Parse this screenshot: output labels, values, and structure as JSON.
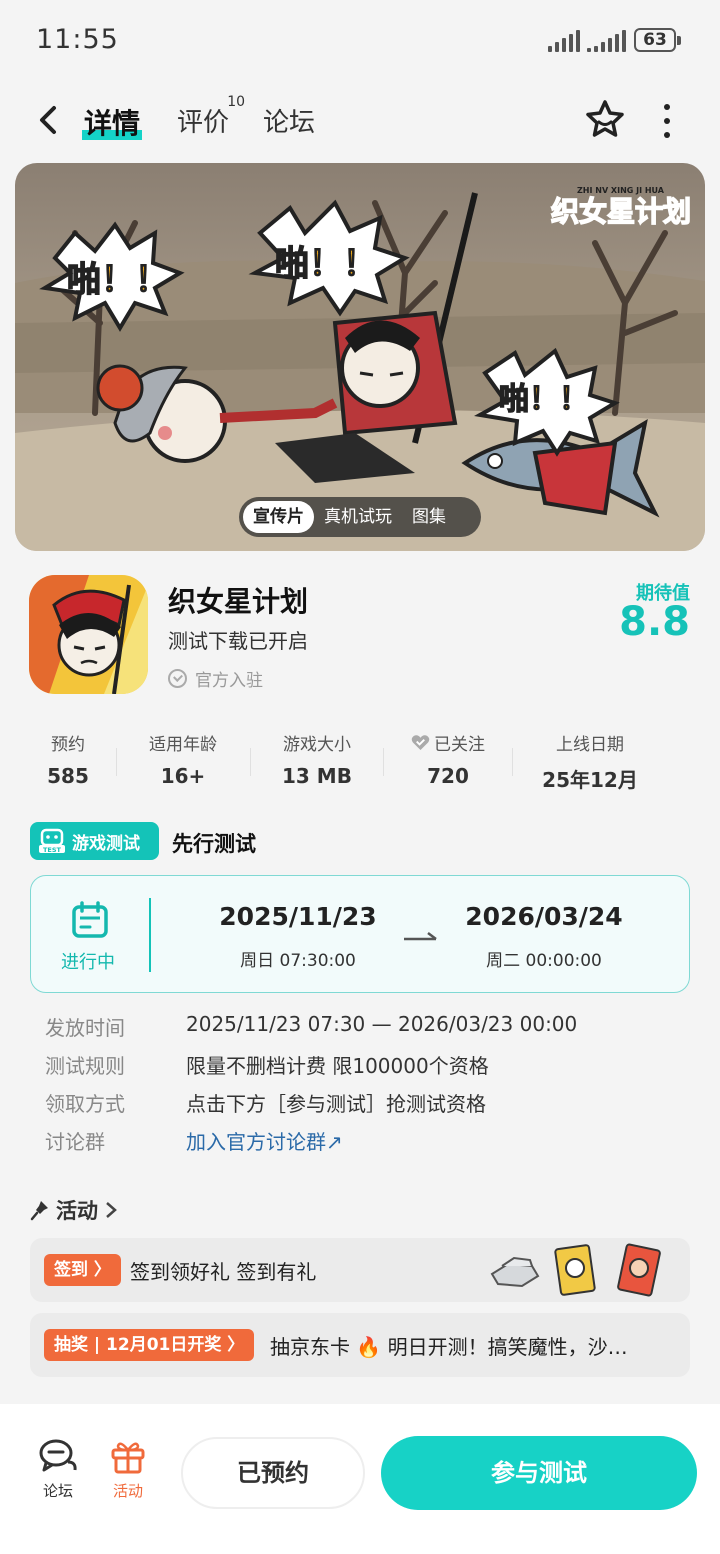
{
  "status_bar": {
    "time": "11:55",
    "battery": "63"
  },
  "nav": {
    "tabs": [
      {
        "label": "详情"
      },
      {
        "label": "评价",
        "badge": "10"
      },
      {
        "label": "论坛"
      }
    ]
  },
  "banner": {
    "logo_text": "织女星计划",
    "logo_pinyin": "ZHI NV XING JI HUA",
    "bubble_text": "啪！！",
    "media_tabs": [
      "宣传片",
      "真机试玩",
      "图集"
    ]
  },
  "app": {
    "name": "织女星计划",
    "subtitle": "测试下载已开启",
    "official": "官方入驻",
    "expect_label": "期待值",
    "expect_value": "8.8"
  },
  "stats": [
    {
      "label": "预约",
      "value": "585"
    },
    {
      "label": "适用年龄",
      "value": "16+"
    },
    {
      "label": "游戏大小",
      "value": "13 MB"
    },
    {
      "label": "已关注",
      "value": "720"
    },
    {
      "label": "上线日期",
      "value": "25年12月"
    }
  ],
  "test": {
    "badge": "游戏测试",
    "badge_icon_text": "TEST",
    "title": "先行测试",
    "status": "进行中",
    "start_date": "2025/11/23",
    "start_time": "周日  07:30:00",
    "end_date": "2026/03/24",
    "end_time": "周二   00:00:00",
    "rules": [
      {
        "key": "发放时间",
        "value": "2025/11/23 07:30 — 2026/03/23 00:00"
      },
      {
        "key": "测试规则",
        "value": "限量不删档计费 限100000个资格"
      },
      {
        "key": "领取方式",
        "value": "点击下方［参与测试］抢测试资格"
      },
      {
        "key": "讨论群",
        "value": "加入官方讨论群↗"
      }
    ]
  },
  "activity": {
    "title": "活动",
    "items": [
      {
        "tag": "签到 〉",
        "text": "签到领好礼 签到有礼"
      },
      {
        "tag": "抽奖 | 12月01日开奖 〉",
        "text": "抽京东卡 🔥 明日开测！搞笑魔性，沙…"
      }
    ]
  },
  "bottom": {
    "forum": "论坛",
    "activity": "活动",
    "reserved": "已预约",
    "join": "参与测试"
  },
  "colors": {
    "accent": "#14d3c8",
    "orange": "#f06a3b",
    "link": "#2b6aa8"
  }
}
